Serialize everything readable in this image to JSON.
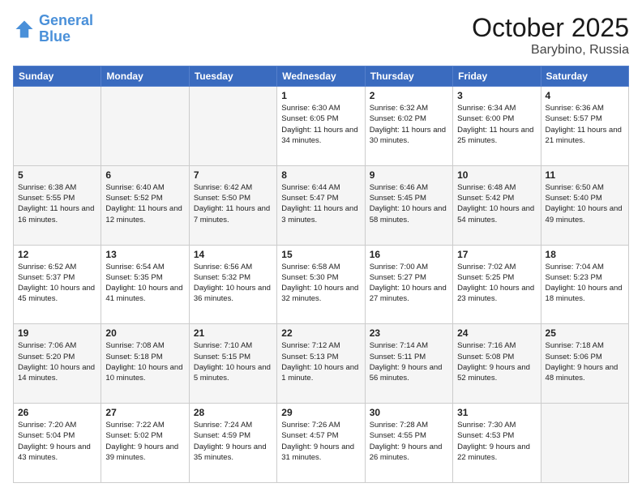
{
  "header": {
    "logo_line1": "General",
    "logo_line2": "Blue",
    "month": "October 2025",
    "location": "Barybino, Russia"
  },
  "weekdays": [
    "Sunday",
    "Monday",
    "Tuesday",
    "Wednesday",
    "Thursday",
    "Friday",
    "Saturday"
  ],
  "weeks": [
    [
      {
        "day": "",
        "info": ""
      },
      {
        "day": "",
        "info": ""
      },
      {
        "day": "",
        "info": ""
      },
      {
        "day": "1",
        "info": "Sunrise: 6:30 AM\nSunset: 6:05 PM\nDaylight: 11 hours\nand 34 minutes."
      },
      {
        "day": "2",
        "info": "Sunrise: 6:32 AM\nSunset: 6:02 PM\nDaylight: 11 hours\nand 30 minutes."
      },
      {
        "day": "3",
        "info": "Sunrise: 6:34 AM\nSunset: 6:00 PM\nDaylight: 11 hours\nand 25 minutes."
      },
      {
        "day": "4",
        "info": "Sunrise: 6:36 AM\nSunset: 5:57 PM\nDaylight: 11 hours\nand 21 minutes."
      }
    ],
    [
      {
        "day": "5",
        "info": "Sunrise: 6:38 AM\nSunset: 5:55 PM\nDaylight: 11 hours\nand 16 minutes."
      },
      {
        "day": "6",
        "info": "Sunrise: 6:40 AM\nSunset: 5:52 PM\nDaylight: 11 hours\nand 12 minutes."
      },
      {
        "day": "7",
        "info": "Sunrise: 6:42 AM\nSunset: 5:50 PM\nDaylight: 11 hours\nand 7 minutes."
      },
      {
        "day": "8",
        "info": "Sunrise: 6:44 AM\nSunset: 5:47 PM\nDaylight: 11 hours\nand 3 minutes."
      },
      {
        "day": "9",
        "info": "Sunrise: 6:46 AM\nSunset: 5:45 PM\nDaylight: 10 hours\nand 58 minutes."
      },
      {
        "day": "10",
        "info": "Sunrise: 6:48 AM\nSunset: 5:42 PM\nDaylight: 10 hours\nand 54 minutes."
      },
      {
        "day": "11",
        "info": "Sunrise: 6:50 AM\nSunset: 5:40 PM\nDaylight: 10 hours\nand 49 minutes."
      }
    ],
    [
      {
        "day": "12",
        "info": "Sunrise: 6:52 AM\nSunset: 5:37 PM\nDaylight: 10 hours\nand 45 minutes."
      },
      {
        "day": "13",
        "info": "Sunrise: 6:54 AM\nSunset: 5:35 PM\nDaylight: 10 hours\nand 41 minutes."
      },
      {
        "day": "14",
        "info": "Sunrise: 6:56 AM\nSunset: 5:32 PM\nDaylight: 10 hours\nand 36 minutes."
      },
      {
        "day": "15",
        "info": "Sunrise: 6:58 AM\nSunset: 5:30 PM\nDaylight: 10 hours\nand 32 minutes."
      },
      {
        "day": "16",
        "info": "Sunrise: 7:00 AM\nSunset: 5:27 PM\nDaylight: 10 hours\nand 27 minutes."
      },
      {
        "day": "17",
        "info": "Sunrise: 7:02 AM\nSunset: 5:25 PM\nDaylight: 10 hours\nand 23 minutes."
      },
      {
        "day": "18",
        "info": "Sunrise: 7:04 AM\nSunset: 5:23 PM\nDaylight: 10 hours\nand 18 minutes."
      }
    ],
    [
      {
        "day": "19",
        "info": "Sunrise: 7:06 AM\nSunset: 5:20 PM\nDaylight: 10 hours\nand 14 minutes."
      },
      {
        "day": "20",
        "info": "Sunrise: 7:08 AM\nSunset: 5:18 PM\nDaylight: 10 hours\nand 10 minutes."
      },
      {
        "day": "21",
        "info": "Sunrise: 7:10 AM\nSunset: 5:15 PM\nDaylight: 10 hours\nand 5 minutes."
      },
      {
        "day": "22",
        "info": "Sunrise: 7:12 AM\nSunset: 5:13 PM\nDaylight: 10 hours\nand 1 minute."
      },
      {
        "day": "23",
        "info": "Sunrise: 7:14 AM\nSunset: 5:11 PM\nDaylight: 9 hours\nand 56 minutes."
      },
      {
        "day": "24",
        "info": "Sunrise: 7:16 AM\nSunset: 5:08 PM\nDaylight: 9 hours\nand 52 minutes."
      },
      {
        "day": "25",
        "info": "Sunrise: 7:18 AM\nSunset: 5:06 PM\nDaylight: 9 hours\nand 48 minutes."
      }
    ],
    [
      {
        "day": "26",
        "info": "Sunrise: 7:20 AM\nSunset: 5:04 PM\nDaylight: 9 hours\nand 43 minutes."
      },
      {
        "day": "27",
        "info": "Sunrise: 7:22 AM\nSunset: 5:02 PM\nDaylight: 9 hours\nand 39 minutes."
      },
      {
        "day": "28",
        "info": "Sunrise: 7:24 AM\nSunset: 4:59 PM\nDaylight: 9 hours\nand 35 minutes."
      },
      {
        "day": "29",
        "info": "Sunrise: 7:26 AM\nSunset: 4:57 PM\nDaylight: 9 hours\nand 31 minutes."
      },
      {
        "day": "30",
        "info": "Sunrise: 7:28 AM\nSunset: 4:55 PM\nDaylight: 9 hours\nand 26 minutes."
      },
      {
        "day": "31",
        "info": "Sunrise: 7:30 AM\nSunset: 4:53 PM\nDaylight: 9 hours\nand 22 minutes."
      },
      {
        "day": "",
        "info": ""
      }
    ]
  ]
}
